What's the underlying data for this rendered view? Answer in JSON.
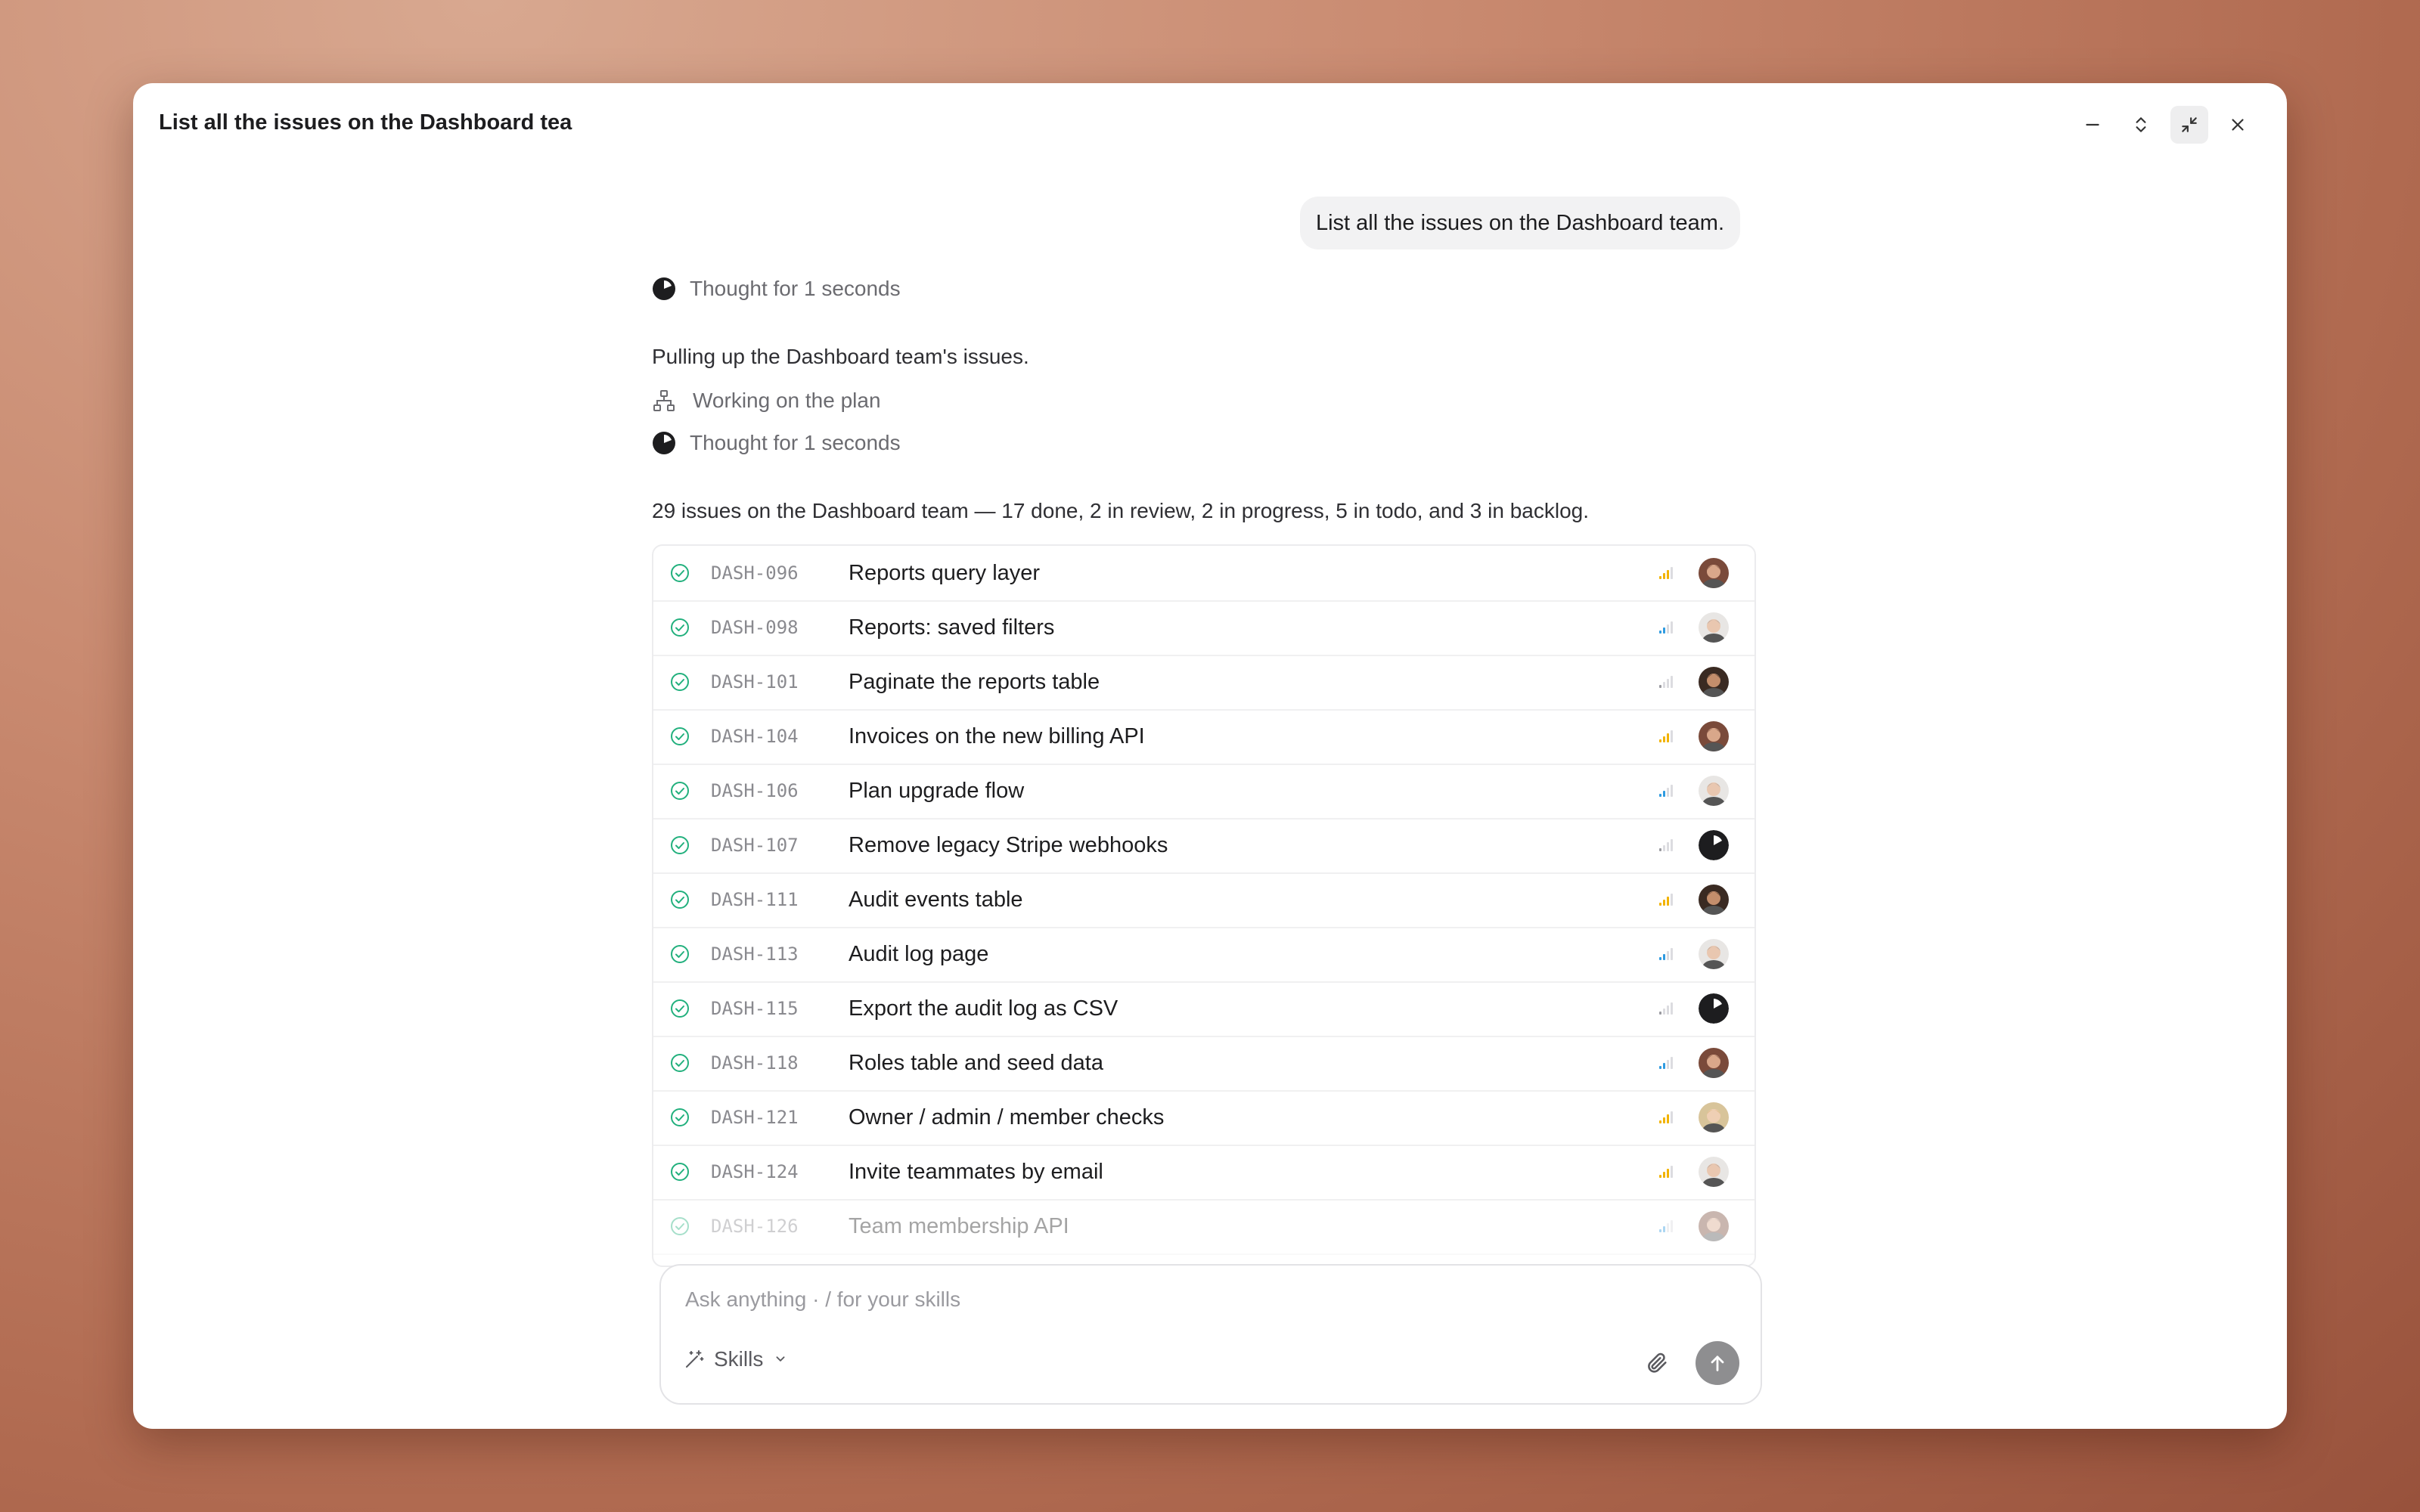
{
  "window": {
    "title": "List all the issues on the Dashboard tea"
  },
  "conversation": {
    "user_message": "List all the issues on the Dashboard team.",
    "thought_1": "Thought for 1 seconds",
    "intro": "Pulling up the Dashboard team's issues.",
    "plan": "Working on the plan",
    "thought_2": "Thought for 1 seconds",
    "summary": "29 issues on the Dashboard team — 17 done, 2 in review, 2 in progress, 5 in todo, and 3 in backlog."
  },
  "issues": [
    {
      "id": "DASH-096",
      "title": "Reports query layer",
      "priority": "medium",
      "avatar": "man-beard"
    },
    {
      "id": "DASH-098",
      "title": "Reports: saved filters",
      "priority": "low",
      "avatar": "man-grey"
    },
    {
      "id": "DASH-101",
      "title": "Paginate the reports table",
      "priority": "none",
      "avatar": "man-dark"
    },
    {
      "id": "DASH-104",
      "title": "Invoices on the new billing API",
      "priority": "medium",
      "avatar": "man-beard"
    },
    {
      "id": "DASH-106",
      "title": "Plan upgrade flow",
      "priority": "low",
      "avatar": "man-grey"
    },
    {
      "id": "DASH-107",
      "title": "Remove legacy Stripe webhooks",
      "priority": "none",
      "avatar": "agent"
    },
    {
      "id": "DASH-111",
      "title": "Audit events table",
      "priority": "medium",
      "avatar": "man-dark"
    },
    {
      "id": "DASH-113",
      "title": "Audit log page",
      "priority": "low",
      "avatar": "man-grey"
    },
    {
      "id": "DASH-115",
      "title": "Export the audit log as CSV",
      "priority": "none",
      "avatar": "agent"
    },
    {
      "id": "DASH-118",
      "title": "Roles table and seed data",
      "priority": "low",
      "avatar": "man-beard"
    },
    {
      "id": "DASH-121",
      "title": "Owner / admin / member checks",
      "priority": "medium",
      "avatar": "woman-blonde"
    },
    {
      "id": "DASH-124",
      "title": "Invite teammates by email",
      "priority": "medium",
      "avatar": "man-grey"
    },
    {
      "id": "DASH-126",
      "title": "Team membership API",
      "priority": "low",
      "avatar": "man-beard"
    }
  ],
  "composer": {
    "placeholder": "Ask anything · / for your skills",
    "skills_label": "Skills"
  },
  "colors": {
    "done": "#22b07d",
    "priority_medium": "#f2b300",
    "priority_low": "#2f9be0",
    "priority_none": "#9a9aa0",
    "send_button": "#8e8e90"
  },
  "icons": {
    "minimize": "minimize-icon",
    "expand": "expand-vertical-icon",
    "collapse": "collapse-icon",
    "close": "close-icon",
    "thought": "thought-pie-icon",
    "plan": "org-chart-icon",
    "status": "done-check-circle-icon",
    "scroll": "arrow-down-icon",
    "skills": "magic-wand-icon",
    "attach": "paperclip-icon",
    "send": "arrow-up-icon"
  }
}
